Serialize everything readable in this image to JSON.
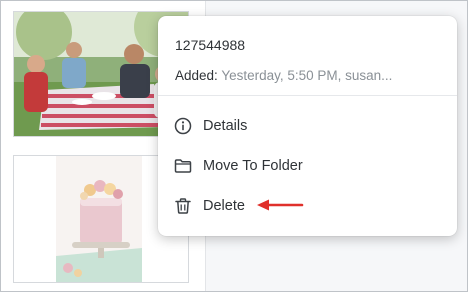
{
  "context_menu": {
    "file_name": "127544988",
    "added_label": "Added:",
    "added_value": "Yesterday, 5:50 PM, susan...",
    "items": [
      {
        "label": "Details",
        "icon": "info-icon"
      },
      {
        "label": "Move To Folder",
        "icon": "folder-icon"
      },
      {
        "label": "Delete",
        "icon": "trash-icon"
      }
    ]
  },
  "thumbnails": [
    {
      "subject": "family-picnic-photo"
    },
    {
      "subject": "cake-photo"
    }
  ],
  "colors": {
    "annotation_arrow": "#e0302b",
    "text": "#2f3337",
    "muted_text": "#8a9096"
  }
}
